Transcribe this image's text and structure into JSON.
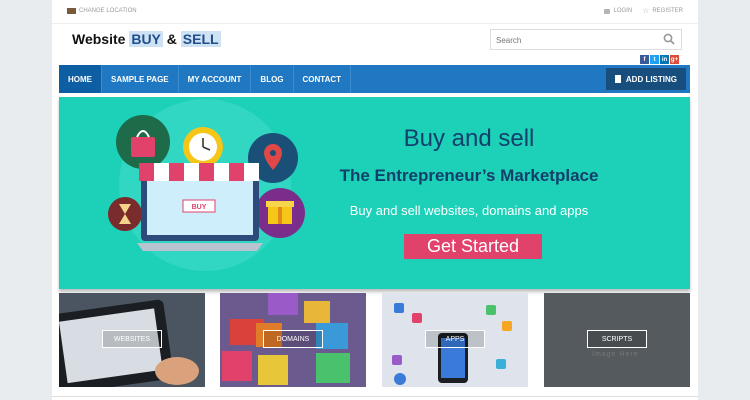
{
  "topbar": {
    "location_label": "CHANGE LOCATION",
    "login_label": "LOGIN",
    "register_label": "REGISTER"
  },
  "header": {
    "logo_word1": "Website",
    "logo_word2": "BUY",
    "logo_amp": "&",
    "logo_word3": "SELL",
    "search_placeholder": "Search",
    "social": [
      "f",
      "t",
      "in",
      "g+"
    ]
  },
  "nav": {
    "items": [
      {
        "label": "HOME",
        "active": true
      },
      {
        "label": "SAMPLE PAGE"
      },
      {
        "label": "MY ACCOUNT"
      },
      {
        "label": "BLOG"
      },
      {
        "label": "CONTACT"
      }
    ],
    "add_listing_label": "ADD LISTING"
  },
  "hero": {
    "title": "Buy and sell",
    "subtitle": "The Entrepreneur’s Marketplace",
    "description": "Buy and sell websites, domains and apps",
    "cta_label": "Get Started",
    "laptop_screen_tag": "BUY"
  },
  "tiles": [
    {
      "label": "WEBSITES",
      "caption": ""
    },
    {
      "label": "DOMAINS",
      "caption": ""
    },
    {
      "label": "APPS",
      "caption": ""
    },
    {
      "label": "SCRIPTS",
      "caption": "Image Here"
    }
  ],
  "colors": {
    "nav_blue": "#1f78c1",
    "hero_teal": "#1dd0b8",
    "cta_pink": "#e0426b",
    "heading_navy": "#12406b"
  }
}
